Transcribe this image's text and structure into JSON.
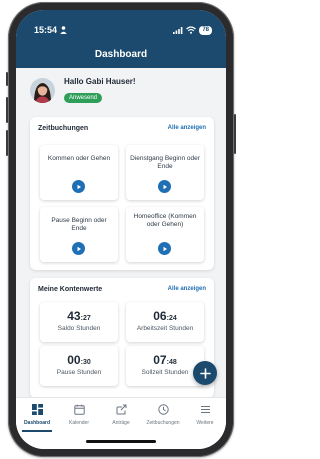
{
  "status_bar": {
    "time": "15:54",
    "battery": "78"
  },
  "header": {
    "title": "Dashboard"
  },
  "welcome": {
    "greeting": "Hallo Gabi Hauser!",
    "status": "Anwesend"
  },
  "time_bookings": {
    "title": "Zeitbuchungen",
    "show_all": "Alle anzeigen",
    "tiles": [
      {
        "label": "Kommen oder Gehen"
      },
      {
        "label": "Dienstgang Beginn oder Ende"
      },
      {
        "label": "Pause Beginn oder Ende"
      },
      {
        "label": "Homeoffice (Kommen oder Gehen)"
      }
    ]
  },
  "accounts": {
    "title": "Meine Kontenwerte",
    "show_all": "Alle anzeigen",
    "items": [
      {
        "major": "43",
        "minor": ":27",
        "label": "Saldo Stunden"
      },
      {
        "major": "06",
        "minor": ":24",
        "label": "Arbeitszeit Stunden"
      },
      {
        "major": "00",
        "minor": ":30",
        "label": "Pause Stunden"
      },
      {
        "major": "07",
        "minor": ":48",
        "label": "Sollzeit Stunden"
      }
    ]
  },
  "tabs": [
    {
      "label": "Dashboard",
      "icon": "dashboard-icon"
    },
    {
      "label": "Kalender",
      "icon": "calendar-icon"
    },
    {
      "label": "Anträge",
      "icon": "requests-icon"
    },
    {
      "label": "Zeitbuchungen",
      "icon": "clock-icon"
    },
    {
      "label": "Weitere",
      "icon": "menu-icon"
    }
  ],
  "colors": {
    "primary": "#1b4a6e",
    "accent": "#1f6fb5",
    "present": "#2f9e58"
  }
}
